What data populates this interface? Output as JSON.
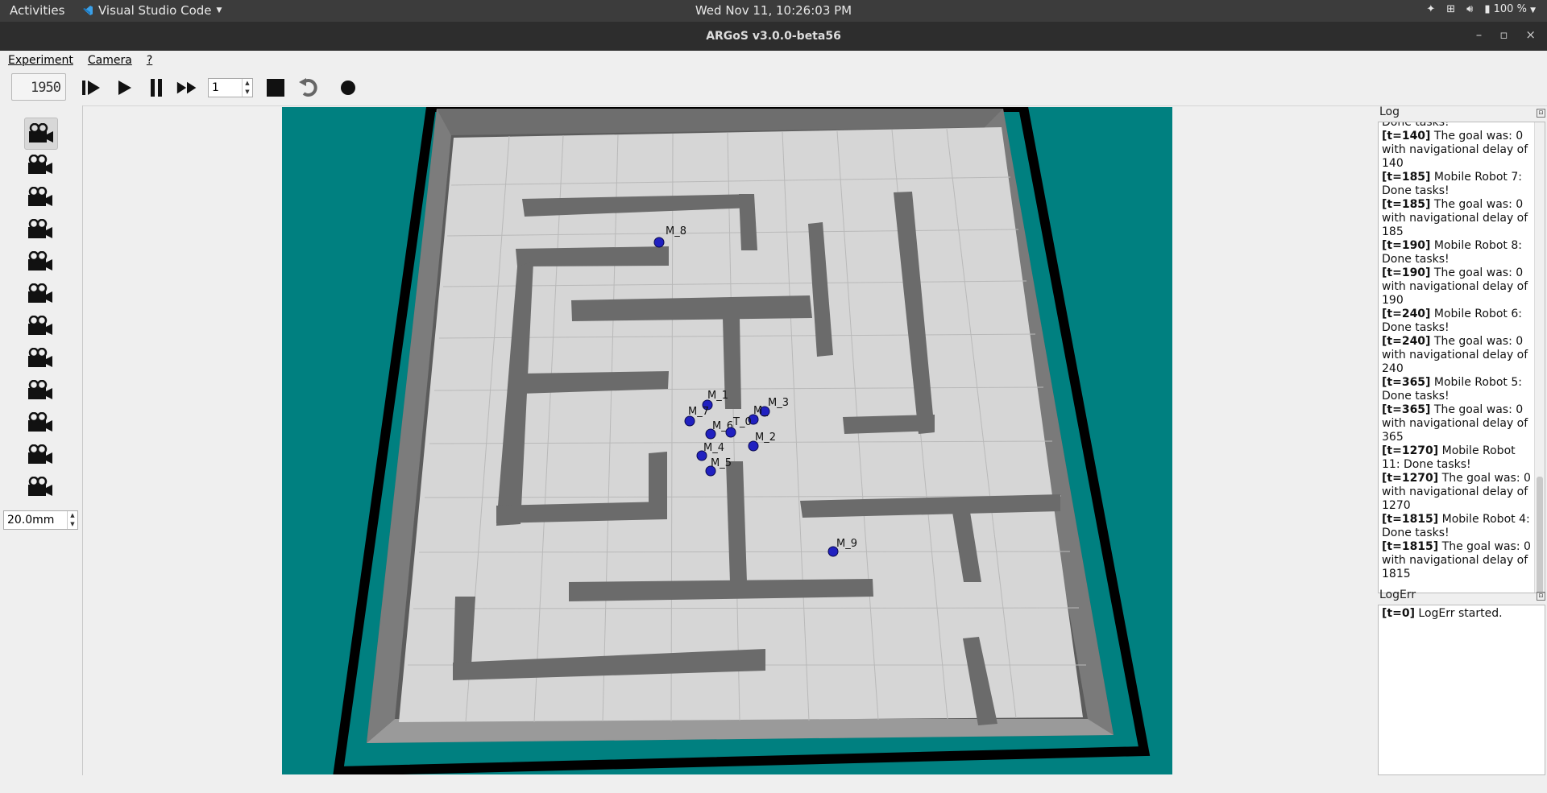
{
  "topbar": {
    "activities": "Activities",
    "app_name": "Visual Studio Code",
    "clock": "Wed Nov 11, 10:26:03 PM",
    "battery": "100 %"
  },
  "window": {
    "title": "ARGoS v3.0.0-beta56"
  },
  "menu": {
    "experiment": "Experiment",
    "camera": "Camera",
    "help": "?"
  },
  "toolbar": {
    "step_counter": "1950",
    "frame_step_value": "1"
  },
  "left_panel": {
    "camera_count": 12,
    "selected_camera": 0,
    "zoom_value": "20.0mm"
  },
  "arena": {
    "robot_labels": {
      "m8": "M_8",
      "m1": "M_1",
      "m7": "M_7",
      "m3": "M_3",
      "m_": "M_",
      "m6": "M_6",
      "t0": "T_0",
      "m2": "M_2",
      "m4": "M_4",
      "m5": "M_5",
      "m9": "M_9"
    }
  },
  "log": {
    "title": "Log",
    "first_line": "Done tasks!",
    "entries": [
      {
        "t": "[t=140]",
        "text": " The goal was: 0 with navigational delay of 140"
      },
      {
        "t": "[t=185]",
        "text": " Mobile Robot 7: Done tasks!"
      },
      {
        "t": "[t=185]",
        "text": " The goal was: 0 with navigational delay of 185"
      },
      {
        "t": "[t=190]",
        "text": " Mobile Robot 8: Done tasks!"
      },
      {
        "t": "[t=190]",
        "text": " The goal was: 0 with navigational delay of 190"
      },
      {
        "t": "[t=240]",
        "text": " Mobile Robot 6: Done tasks!"
      },
      {
        "t": "[t=240]",
        "text": " The goal was: 0 with navigational delay of 240"
      },
      {
        "t": "[t=365]",
        "text": " Mobile Robot 5: Done tasks!"
      },
      {
        "t": "[t=365]",
        "text": " The goal was: 0 with navigational delay of 365"
      },
      {
        "t": "[t=1270]",
        "text": " Mobile Robot 11: Done tasks!"
      },
      {
        "t": "[t=1270]",
        "text": " The goal was: 0 with navigational delay of 1270"
      },
      {
        "t": "[t=1815]",
        "text": " Mobile Robot 4: Done tasks!"
      },
      {
        "t": "[t=1815]",
        "text": " The goal was: 0 with navigational delay of 1815"
      }
    ]
  },
  "logerr": {
    "title": "LogErr",
    "entry_t": "[t=0]",
    "entry_text": " LogErr started."
  }
}
